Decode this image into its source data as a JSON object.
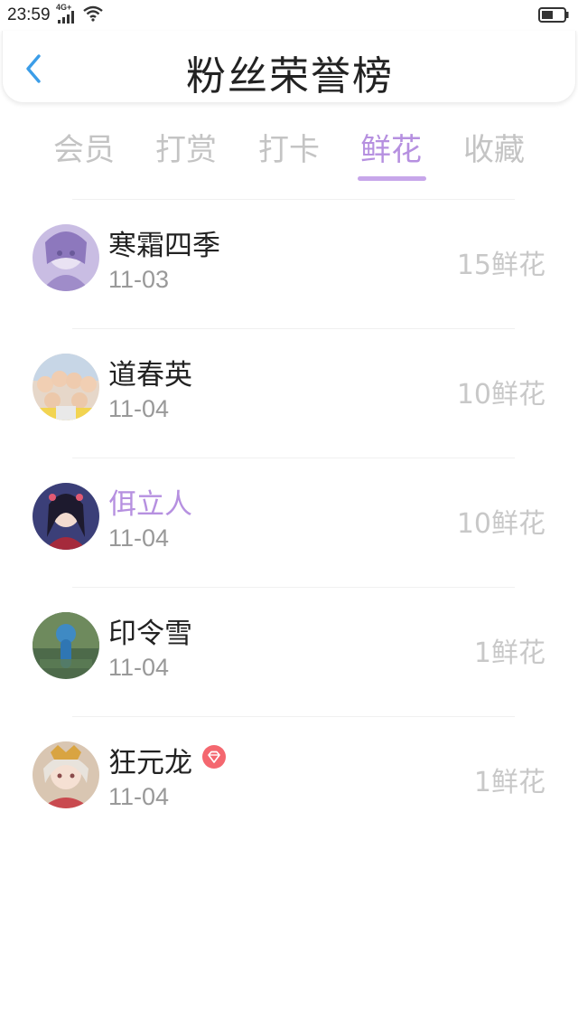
{
  "status_bar": {
    "time": "23:59",
    "network": "4G+",
    "icons": [
      "signal-icon",
      "wifi-icon",
      "battery-icon"
    ]
  },
  "header": {
    "title": "粉丝荣誉榜",
    "back_icon": "chevron-left-icon",
    "accent_color": "#3b9de8"
  },
  "tabs": {
    "items": [
      {
        "label": "会员",
        "active": false
      },
      {
        "label": "打赏",
        "active": false
      },
      {
        "label": "打卡",
        "active": false
      },
      {
        "label": "鲜花",
        "active": true
      },
      {
        "label": "收藏",
        "active": false
      }
    ],
    "active_color": "#b690e0",
    "inactive_color": "#c4c4c4"
  },
  "fans": [
    {
      "name": "寒霜四季",
      "date": "11-03",
      "amount": "15鲜花",
      "vip": false
    },
    {
      "name": "道春英",
      "date": "11-04",
      "amount": "10鲜花",
      "vip": false
    },
    {
      "name": "佴立人",
      "date": "11-04",
      "amount": "10鲜花",
      "vip": true,
      "badge_icon": "diamond-icon"
    },
    {
      "name": "印令雪",
      "date": "11-04",
      "amount": "1鲜花",
      "vip": false
    },
    {
      "name": "狂元龙",
      "date": "11-04",
      "amount": "1鲜花",
      "vip": false
    }
  ]
}
